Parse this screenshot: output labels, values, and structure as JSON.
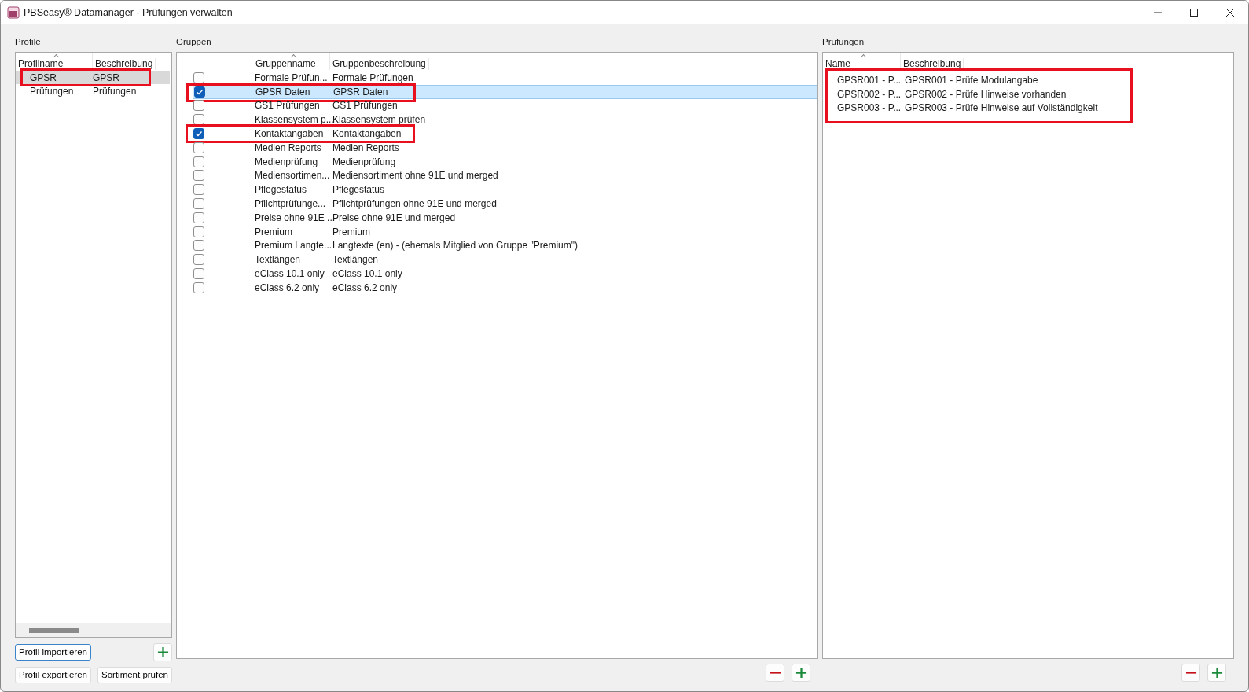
{
  "window": {
    "title": "PBSeasy® Datamanager - Prüfungen verwalten"
  },
  "profiles": {
    "label": "Profile",
    "columns": [
      "Profilname",
      "Beschreibung"
    ],
    "rows": [
      {
        "name": "GPSR",
        "description": "GPSR",
        "selected": true,
        "highlighted": true
      },
      {
        "name": "Prüfungen",
        "description": "Prüfungen",
        "selected": false,
        "highlighted": false
      }
    ],
    "buttons": [
      "Profil importieren",
      "Profil exportieren",
      "Sortiment prüfen"
    ]
  },
  "groups": {
    "label": "Gruppen",
    "columns": [
      "Gruppenname",
      "Gruppenbeschreibung"
    ],
    "rows": [
      {
        "name": "Formale Prüfun...",
        "description": "Formale Prüfungen",
        "checked": false,
        "selected": false,
        "highlighted": false
      },
      {
        "name": "GPSR Daten",
        "description": "GPSR Daten",
        "checked": true,
        "selected": true,
        "highlighted": true
      },
      {
        "name": "GS1 Prüfungen",
        "description": "GS1 Prüfungen",
        "checked": false,
        "selected": false,
        "highlighted": false
      },
      {
        "name": "Klassensystem p...",
        "description": "Klassensystem prüfen",
        "checked": false,
        "selected": false,
        "highlighted": false
      },
      {
        "name": "Kontaktangaben",
        "description": "Kontaktangaben",
        "checked": true,
        "selected": false,
        "highlighted": true
      },
      {
        "name": "Medien Reports",
        "description": "Medien Reports",
        "checked": false,
        "selected": false,
        "highlighted": false
      },
      {
        "name": "Medienprüfung",
        "description": "Medienprüfung",
        "checked": false,
        "selected": false,
        "highlighted": false
      },
      {
        "name": "Mediensortimen...",
        "description": "Mediensortiment ohne 91E und merged",
        "checked": false,
        "selected": false,
        "highlighted": false
      },
      {
        "name": "Pflegestatus",
        "description": "Pflegestatus",
        "checked": false,
        "selected": false,
        "highlighted": false
      },
      {
        "name": "Pflichtprüfunge...",
        "description": "Pflichtprüfungen ohne 91E und merged",
        "checked": false,
        "selected": false,
        "highlighted": false
      },
      {
        "name": "Preise ohne 91E ...",
        "description": "Preise ohne 91E und merged",
        "checked": false,
        "selected": false,
        "highlighted": false
      },
      {
        "name": "Premium",
        "description": "Premium",
        "checked": false,
        "selected": false,
        "highlighted": false
      },
      {
        "name": "Premium Langte...",
        "description": "Langtexte (en) - (ehemals Mitglied von Gruppe \"Premium\")",
        "checked": false,
        "selected": false,
        "highlighted": false
      },
      {
        "name": "Textlängen",
        "description": "Textlängen",
        "checked": false,
        "selected": false,
        "highlighted": false
      },
      {
        "name": "eClass 10.1 only",
        "description": "eClass 10.1 only",
        "checked": false,
        "selected": false,
        "highlighted": false
      },
      {
        "name": "eClass 6.2 only",
        "description": "eClass 6.2 only",
        "checked": false,
        "selected": false,
        "highlighted": false
      }
    ]
  },
  "checks": {
    "label": "Prüfungen",
    "columns": [
      "Name",
      "Beschreibung"
    ],
    "highlighted": true,
    "rows": [
      {
        "name": "GPSR001 - P...",
        "description": "GPSR001 - Prüfe Modulangabe"
      },
      {
        "name": "GPSR002 - P...",
        "description": "GPSR002 - Prüfe Hinweise vorhanden"
      },
      {
        "name": "GPSR003 - P...",
        "description": "GPSR003 - Prüfe Hinweise auf Vollständigkeit"
      }
    ]
  }
}
